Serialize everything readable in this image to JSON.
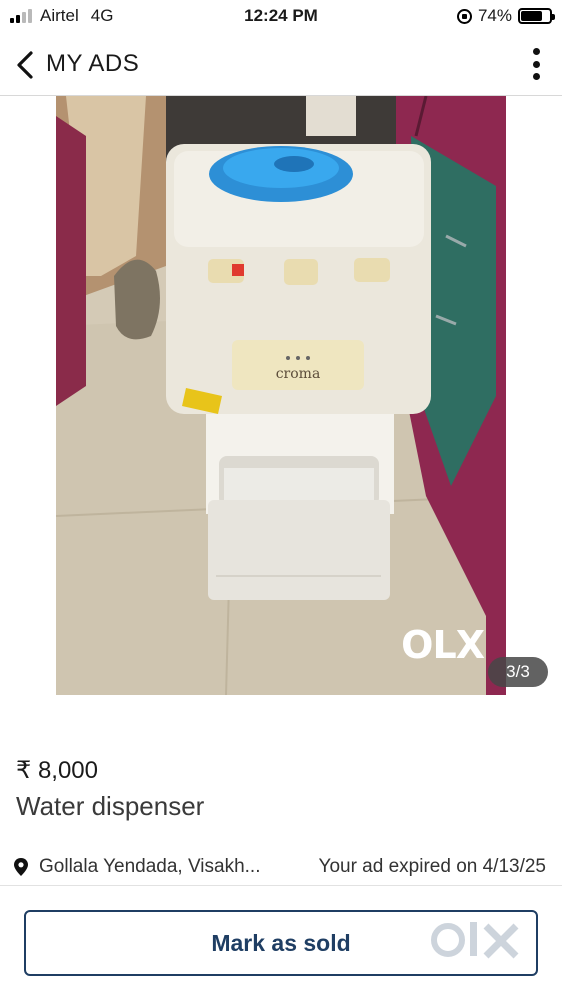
{
  "status_bar": {
    "carrier": "Airtel",
    "network": "4G",
    "time": "12:24 PM",
    "battery": "74%",
    "battery_level": 0.74,
    "signal_bars_on": 2,
    "signal_bars_total": 4
  },
  "header": {
    "title": "MY ADS",
    "back_icon": "chevron-left-icon",
    "more_icon": "more-vertical-icon"
  },
  "gallery": {
    "counter": "3/3",
    "watermark": "OLX",
    "photo_brand_text": "croma"
  },
  "ad": {
    "price": "₹ 8,000",
    "title": "Water dispenser",
    "location": "Gollala Yendada, Visakh...",
    "status": "Your ad expired on 4/13/25",
    "location_icon": "map-pin-icon"
  },
  "actions": {
    "mark_sold_label": "Mark as sold",
    "accent_color": "#1f3e63"
  }
}
